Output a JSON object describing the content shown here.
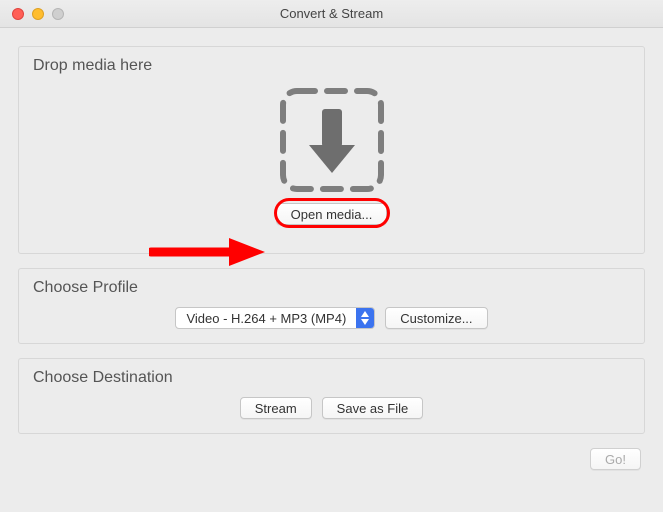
{
  "window": {
    "title": "Convert & Stream"
  },
  "drop": {
    "group_title": "Drop media here",
    "open_media_label": "Open media..."
  },
  "profile": {
    "group_title": "Choose Profile",
    "selected": "Video - H.264 + MP3 (MP4)",
    "customize_label": "Customize..."
  },
  "destination": {
    "group_title": "Choose Destination",
    "stream_label": "Stream",
    "save_label": "Save as File"
  },
  "footer": {
    "go_label": "Go!"
  }
}
